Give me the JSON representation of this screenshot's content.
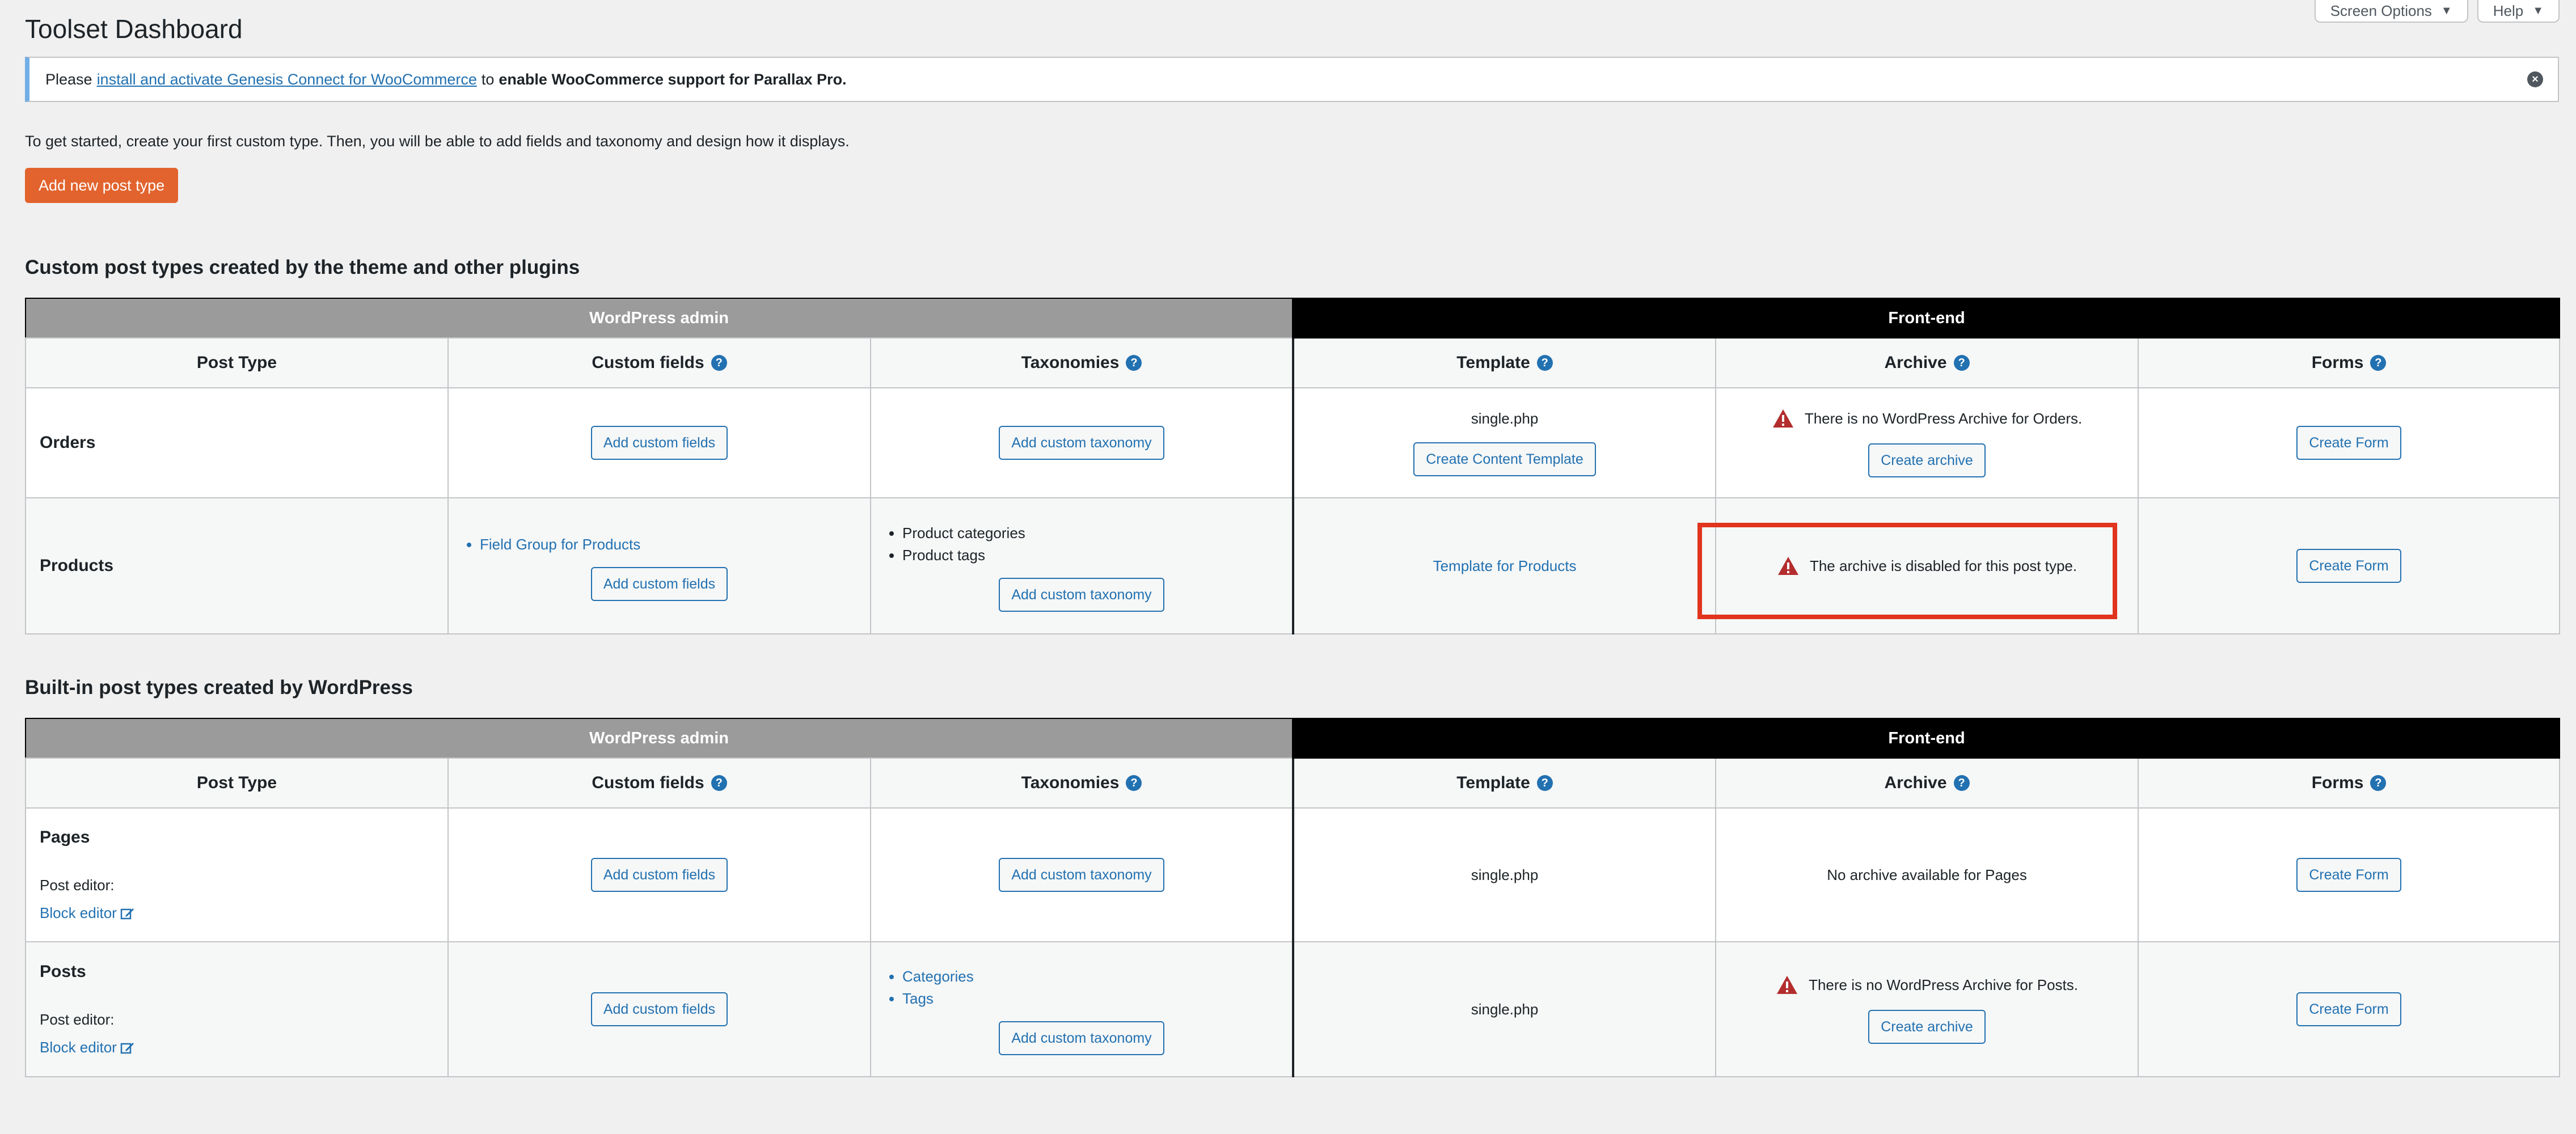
{
  "screen_options": {
    "screen_options_label": "Screen Options",
    "help_label": "Help"
  },
  "page_title": "Toolset Dashboard",
  "notice": {
    "prefix": "Please",
    "link": "install and activate Genesis Connect for WooCommerce",
    "middle": "to",
    "bold": "enable WooCommerce support for Parallax Pro."
  },
  "intro": "To get started, create your first custom type. Then, you will be able to add fields and taxonomy and design how it displays.",
  "add_post_type_label": "Add new post type",
  "headers": {
    "wp_admin": "WordPress admin",
    "front_end": "Front-end",
    "post_type": "Post Type",
    "custom_fields": "Custom fields",
    "taxonomies": "Taxonomies",
    "template": "Template",
    "archive": "Archive",
    "forms": "Forms",
    "help_glyph": "?"
  },
  "labels": {
    "add_custom_fields": "Add custom fields",
    "add_custom_taxonomy": "Add custom taxonomy",
    "create_content_template": "Create Content Template",
    "create_archive": "Create archive",
    "create_form": "Create Form",
    "post_editor": "Post editor:",
    "block_editor": "Block editor"
  },
  "section1": {
    "title": "Custom post types created by the theme and other plugins",
    "orders": {
      "name": "Orders",
      "template": "single.php",
      "archive_msg": "There is no WordPress Archive for Orders."
    },
    "products": {
      "name": "Products",
      "field_group": "Field Group for Products",
      "taxonomies": [
        "Product categories",
        "Product tags"
      ],
      "template_link": "Template for Products",
      "archive_msg": "The archive is disabled for this post type."
    }
  },
  "section2": {
    "title": "Built-in post types created by WordPress",
    "pages": {
      "name": "Pages",
      "template": "single.php",
      "archive_msg": "No archive available for Pages"
    },
    "posts": {
      "name": "Posts",
      "taxonomies": [
        "Categories",
        "Tags"
      ],
      "template": "single.php",
      "archive_msg": "There is no WordPress Archive for Posts."
    }
  },
  "colors": {
    "accent": "#2271b1",
    "primary_button": "#e2632d",
    "warning": "#b32d2e",
    "highlight": "#e1341e",
    "admin_header": "#9b9b9b",
    "front_header": "#000000"
  }
}
